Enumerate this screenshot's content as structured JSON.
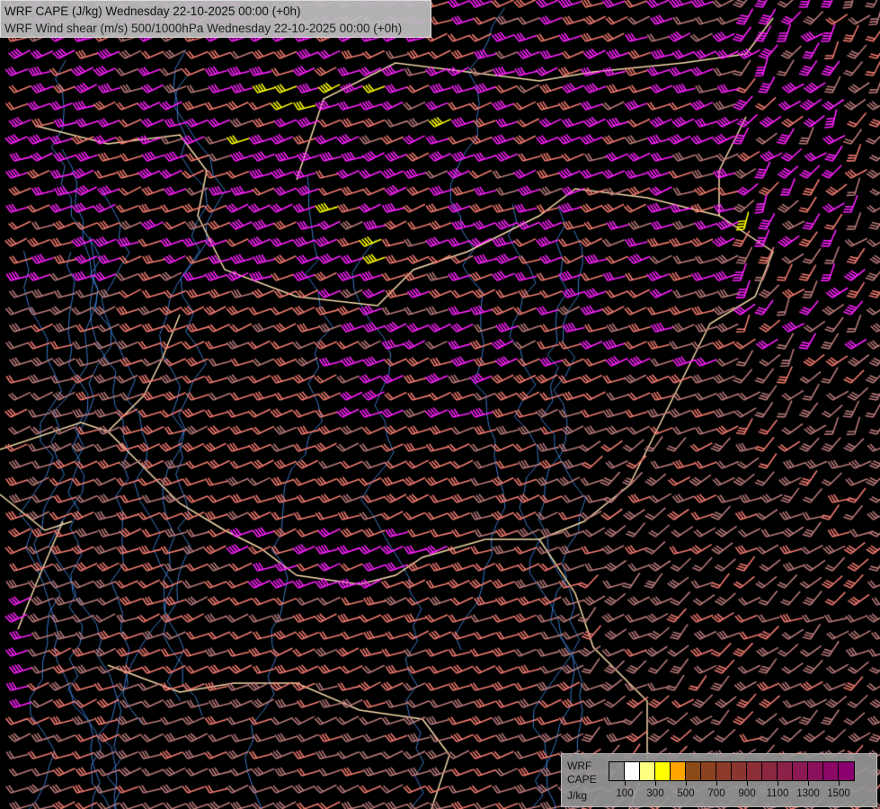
{
  "header": {
    "line1": "WRF CAPE (J/kg) Wednesday 22-10-2025 00:00 (+0h)",
    "line2": "WRF Wind shear (m/s) 500/1000hPa Wednesday 22-10-2025 00:00 (+0h)"
  },
  "legend": {
    "label1": "WRF",
    "label2": "CAPE",
    "unit": "J/kg",
    "colors": [
      "#808080",
      "#ffffff",
      "#ffff80",
      "#ffff00",
      "#ffa500",
      "#8c4a17",
      "#8b421f",
      "#8b3b28",
      "#8b3530",
      "#8b2e38",
      "#8b2840",
      "#8b2148",
      "#8b1a52",
      "#8b115c",
      "#8b0866",
      "#8b006e"
    ],
    "ticks": [
      "100",
      "300",
      "500",
      "700",
      "900",
      "1100",
      "1300",
      "1500"
    ]
  },
  "palette": {
    "barb_magenta": "#ff20ff",
    "barb_salmon": "#f07a70",
    "barb_rose": "#b87878",
    "barb_yellow": "#ffff00",
    "border": "#f5d8a8",
    "river": "#3a78c8"
  }
}
